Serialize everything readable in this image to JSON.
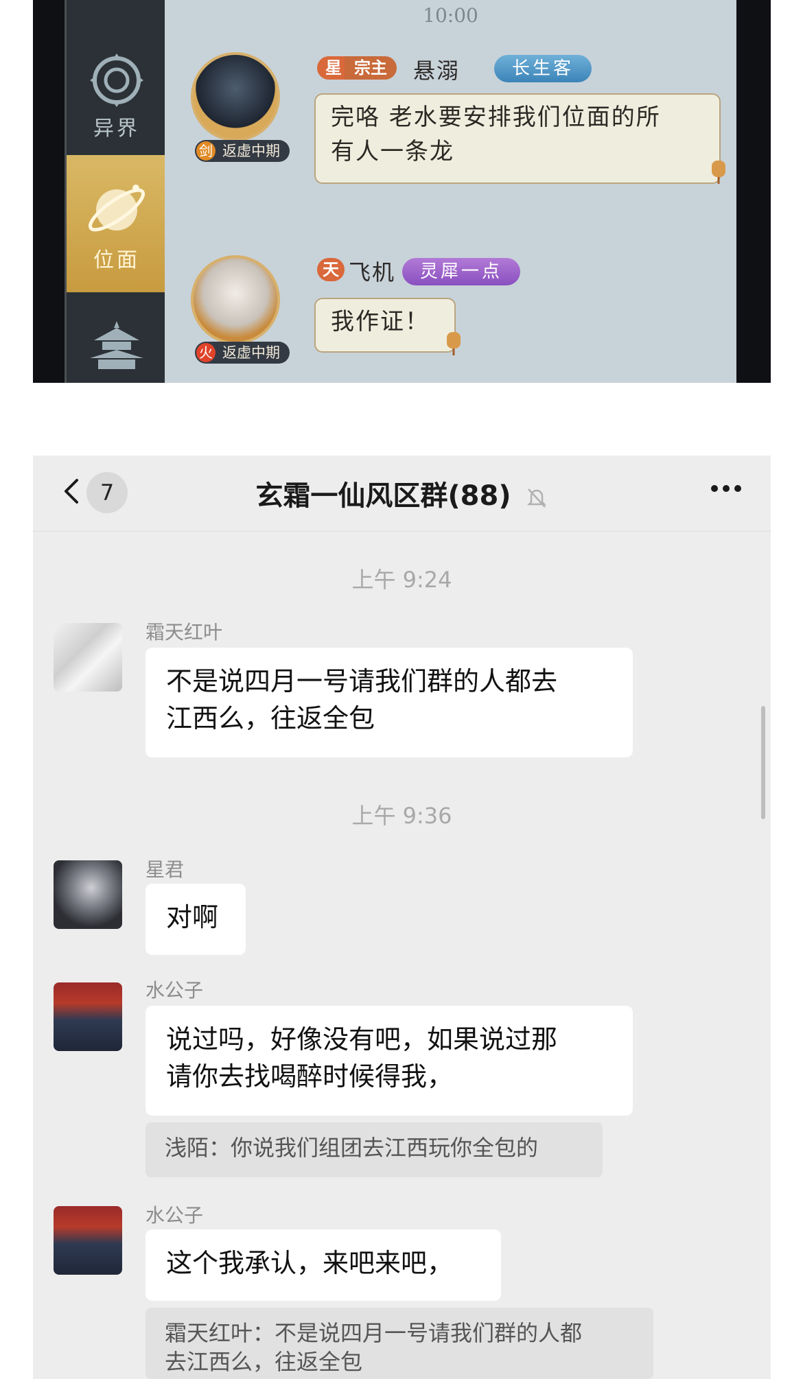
{
  "game": {
    "time": "10:00",
    "sidebar": [
      {
        "label": "异界",
        "icon": "portal-icon",
        "active": false
      },
      {
        "label": "位面",
        "icon": "planet-icon",
        "active": true
      },
      {
        "label": "",
        "icon": "pagoda-icon",
        "active": false
      }
    ],
    "messages": [
      {
        "element": "剑",
        "realm": "返虚中期",
        "star_tag": "星",
        "role_tag": "宗主",
        "name": "悬溺",
        "title": "长生客",
        "text_line1": "完咯 老水要安排我们位面的所",
        "text_line2": "有人一条龙"
      },
      {
        "element": "火",
        "realm": "返虚中期",
        "star_tag": "天",
        "name": "飞机",
        "title": "灵犀一点",
        "text": "我作证！"
      }
    ]
  },
  "wechat": {
    "header": {
      "unread_count": "7",
      "title": "玄霜一仙风区群(88)"
    },
    "times": [
      "上午 9:24",
      "上午 9:36"
    ],
    "messages": [
      {
        "sender": "霜天红叶",
        "line1": "不是说四月一号请我们群的人都去",
        "line2": "江西么，往返全包"
      },
      {
        "sender": "星君",
        "text": "对啊"
      },
      {
        "sender": "水公子",
        "line1": "说过吗，好像没有吧，如果说过那",
        "line2": "请你去找喝醉时候得我，",
        "quote": "浅陌：你说我们组团去江西玩你全包的"
      },
      {
        "sender": "水公子",
        "text": "这个我承认，来吧来吧，",
        "quote_line1": "霜天红叶：不是说四月一号请我们群的人都",
        "quote_line2": "去江西么，往返全包"
      }
    ]
  }
}
